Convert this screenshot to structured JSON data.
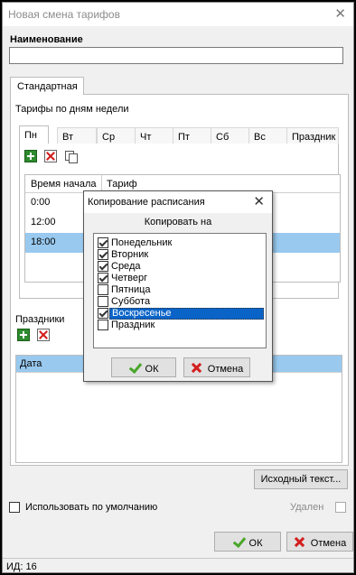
{
  "window": {
    "title": "Новая смена тарифов"
  },
  "name_section": {
    "label": "Наименование",
    "value": ""
  },
  "tabs": [
    {
      "label": "Стандартная"
    }
  ],
  "week": {
    "group_label": "Тарифы по дням недели",
    "days": [
      "Пн",
      "Вт",
      "Ср",
      "Чт",
      "Пт",
      "Сб",
      "Вс",
      "Праздник"
    ],
    "active_day": "Пн",
    "columns": [
      "Время начала",
      "Тариф"
    ],
    "rows": [
      {
        "time": "0:00",
        "tariff": ""
      },
      {
        "time": "12:00",
        "tariff": ""
      },
      {
        "time": "18:00",
        "tariff": ""
      }
    ]
  },
  "holidays": {
    "group_label": "Праздники",
    "columns": [
      "Дата"
    ]
  },
  "source_button": "Исходный текст...",
  "use_default": {
    "label": "Использовать по умолчанию",
    "checked": false
  },
  "deleted": {
    "label": "Удален",
    "checked": false
  },
  "footer": {
    "ok": "ОК",
    "cancel": "Отмена"
  },
  "status": {
    "text": "ИД: 16"
  },
  "dialog": {
    "title": "Копирование расписания",
    "subtitle": "Копировать на",
    "items": [
      {
        "label": "Понедельник",
        "checked": true
      },
      {
        "label": "Вторник",
        "checked": true
      },
      {
        "label": "Среда",
        "checked": true
      },
      {
        "label": "Четверг",
        "checked": true
      },
      {
        "label": "Пятница",
        "checked": false
      },
      {
        "label": "Суббота",
        "checked": false
      },
      {
        "label": "Воскресенье",
        "checked": true,
        "selected": true
      },
      {
        "label": "Праздник",
        "checked": false
      }
    ],
    "ok": "ОК",
    "cancel": "Отмена"
  },
  "colors": {
    "selection": "#99c9ef",
    "list_highlight": "#0a64c8",
    "ok_green": "#4aa62a",
    "cancel_red": "#d31f1f"
  }
}
